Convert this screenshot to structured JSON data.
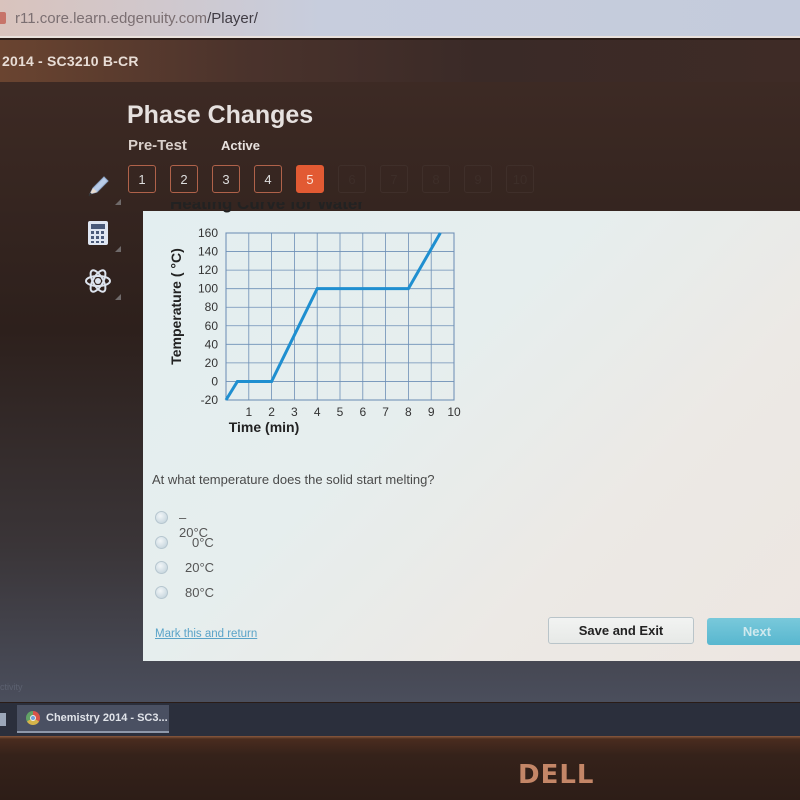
{
  "browser": {
    "url_host": "r11.core.learn.edgenuity.com",
    "url_path": "/Player/"
  },
  "course": {
    "title": "2014 - SC3210 B-CR"
  },
  "lesson": {
    "title": "Phase Changes",
    "assessment_type": "Pre-Test",
    "status": "Active"
  },
  "question_nav": {
    "current": 5,
    "items": [
      {
        "label": "1",
        "state": "answered"
      },
      {
        "label": "2",
        "state": "answered"
      },
      {
        "label": "3",
        "state": "answered"
      },
      {
        "label": "4",
        "state": "answered"
      },
      {
        "label": "5",
        "state": "current"
      },
      {
        "label": "6",
        "state": "locked"
      },
      {
        "label": "7",
        "state": "locked"
      },
      {
        "label": "8",
        "state": "locked"
      },
      {
        "label": "9",
        "state": "locked"
      },
      {
        "label": "10",
        "state": "locked"
      }
    ]
  },
  "tools": [
    {
      "name": "pencil-icon",
      "label": "Highlighter"
    },
    {
      "name": "calculator-icon",
      "label": "Calculator"
    },
    {
      "name": "atom-icon",
      "label": "Periodic Table"
    }
  ],
  "chart_data": {
    "type": "line",
    "title": "Heating Curve for Water",
    "xlabel": "Time (min)",
    "ylabel": "Temperature ( °C)",
    "xlim": [
      0,
      10
    ],
    "ylim": [
      -20,
      160
    ],
    "x_ticks": [
      1,
      2,
      3,
      4,
      5,
      6,
      7,
      8,
      9,
      10
    ],
    "y_ticks": [
      -20,
      0,
      20,
      40,
      60,
      80,
      100,
      120,
      140,
      160
    ],
    "grid": true,
    "line_color": "#1f8fd0",
    "series": [
      {
        "name": "Water",
        "x": [
          0,
          0.5,
          2,
          4,
          8,
          9.4
        ],
        "y": [
          -20,
          0,
          0,
          100,
          100,
          160
        ]
      }
    ]
  },
  "question": {
    "text": "At what temperature does the solid start melting?",
    "options": [
      "–20°C",
      "0°C",
      "20°C",
      "80°C"
    ],
    "selected": null
  },
  "actions": {
    "mark_link": "Mark this and return",
    "save_exit": "Save and Exit",
    "next": "Next"
  },
  "footer": {
    "faint_text": "ctivity"
  },
  "taskbar": {
    "active_window": "Chemistry 2014 - SC3..."
  },
  "bezel": {
    "brand": "DELL"
  }
}
